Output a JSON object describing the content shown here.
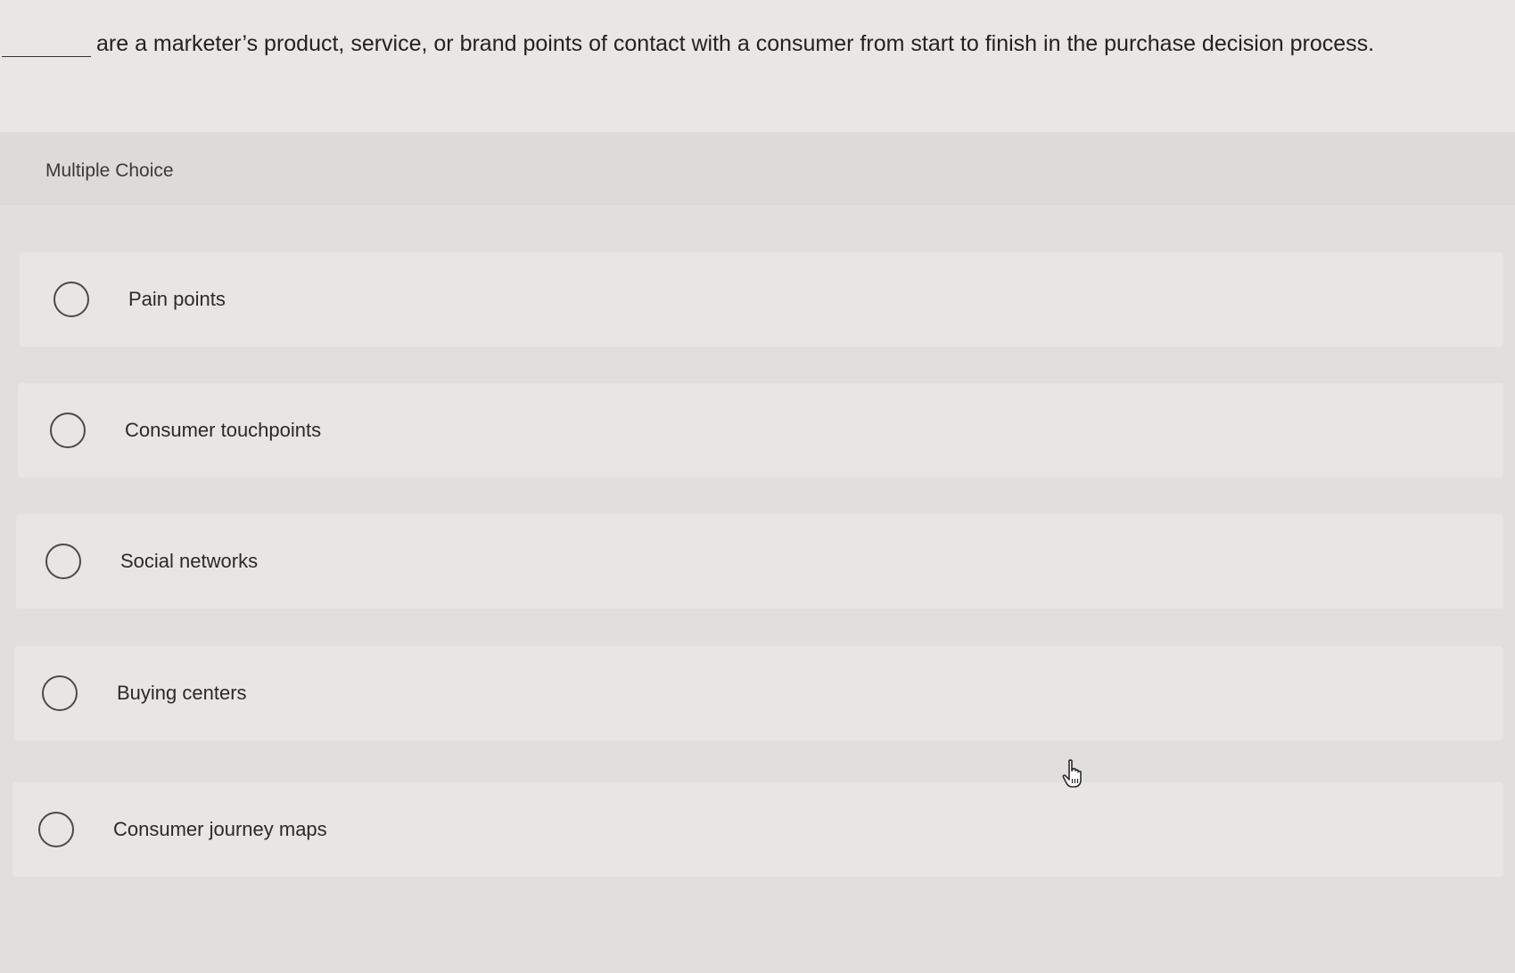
{
  "question": {
    "text": "are a marketer’s product, service, or brand points of contact with a consumer from start to finish in the purchase decision process."
  },
  "section": {
    "label": "Multiple Choice"
  },
  "options": [
    {
      "label": "Pain points"
    },
    {
      "label": "Consumer touchpoints"
    },
    {
      "label": "Social networks"
    },
    {
      "label": "Buying centers"
    },
    {
      "label": "Consumer journey maps"
    }
  ],
  "icons": {
    "radio": "radio-unselected-icon",
    "cursor": "hand-pointer-icon"
  }
}
